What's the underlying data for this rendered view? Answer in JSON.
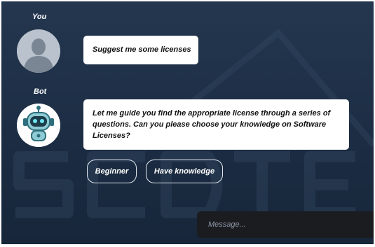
{
  "conversation": {
    "user": {
      "label": "You",
      "message": "Suggest me some licenses"
    },
    "bot": {
      "label": "Bot",
      "message": "Let me guide you find the appropriate license through a series of questions. Can you please choose your knowledge on Software Licenses?"
    }
  },
  "options": [
    {
      "label": "Beginner"
    },
    {
      "label": "Have knowledge"
    }
  ],
  "composer": {
    "placeholder": "Message..."
  },
  "icons": {
    "user_avatar": "user-silhouette-icon",
    "bot_avatar": "robot-icon"
  },
  "colors": {
    "background": "#20334a",
    "bubble": "#ffffff",
    "composer": "#1b1c20"
  }
}
